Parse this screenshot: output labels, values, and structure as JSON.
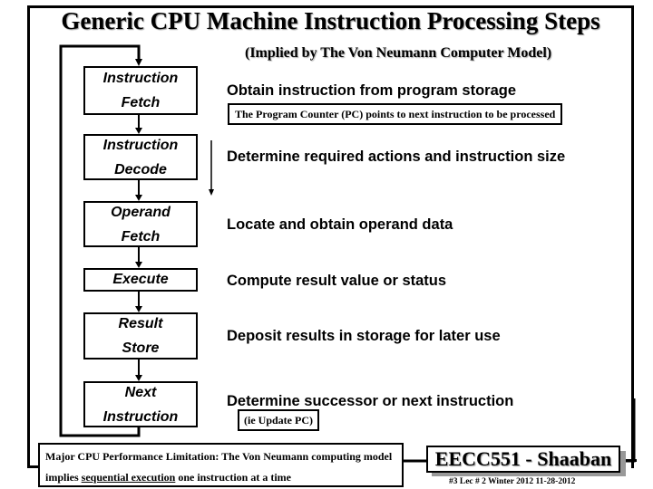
{
  "title": "Generic CPU Machine Instruction Processing Steps",
  "subtitle": "(Implied by The Von Neumann Computer Model)",
  "steps": [
    {
      "line1": "Instruction",
      "line2": "Fetch",
      "description": "Obtain instruction from program storage"
    },
    {
      "line1": "Instruction",
      "line2": "Decode",
      "description": "Determine required actions and instruction size"
    },
    {
      "line1": "Operand",
      "line2": "Fetch",
      "description": "Locate and obtain operand data"
    },
    {
      "line1": "Execute",
      "line2": "",
      "description": "Compute result value or status"
    },
    {
      "line1": "Result",
      "line2": "Store",
      "description": "Deposit results in storage for later use"
    },
    {
      "line1": "Next",
      "line2": "Instruction",
      "description": "Determine successor or next instruction"
    }
  ],
  "notes": {
    "pc_note": "The Program Counter (PC) points to next instruction to be processed",
    "update_pc": "(ie Update PC)"
  },
  "limitation": {
    "line1": "Major CPU Performance Limitation:  The Von Neumann computing model",
    "line2_prefix": "implies ",
    "line2_underlined": "sequential execution",
    "line2_suffix": " one instruction at a time"
  },
  "brand": "EECC551 - Shaaban",
  "footer": "#3   Lec # 2   Winter 2012   11-28-2012"
}
